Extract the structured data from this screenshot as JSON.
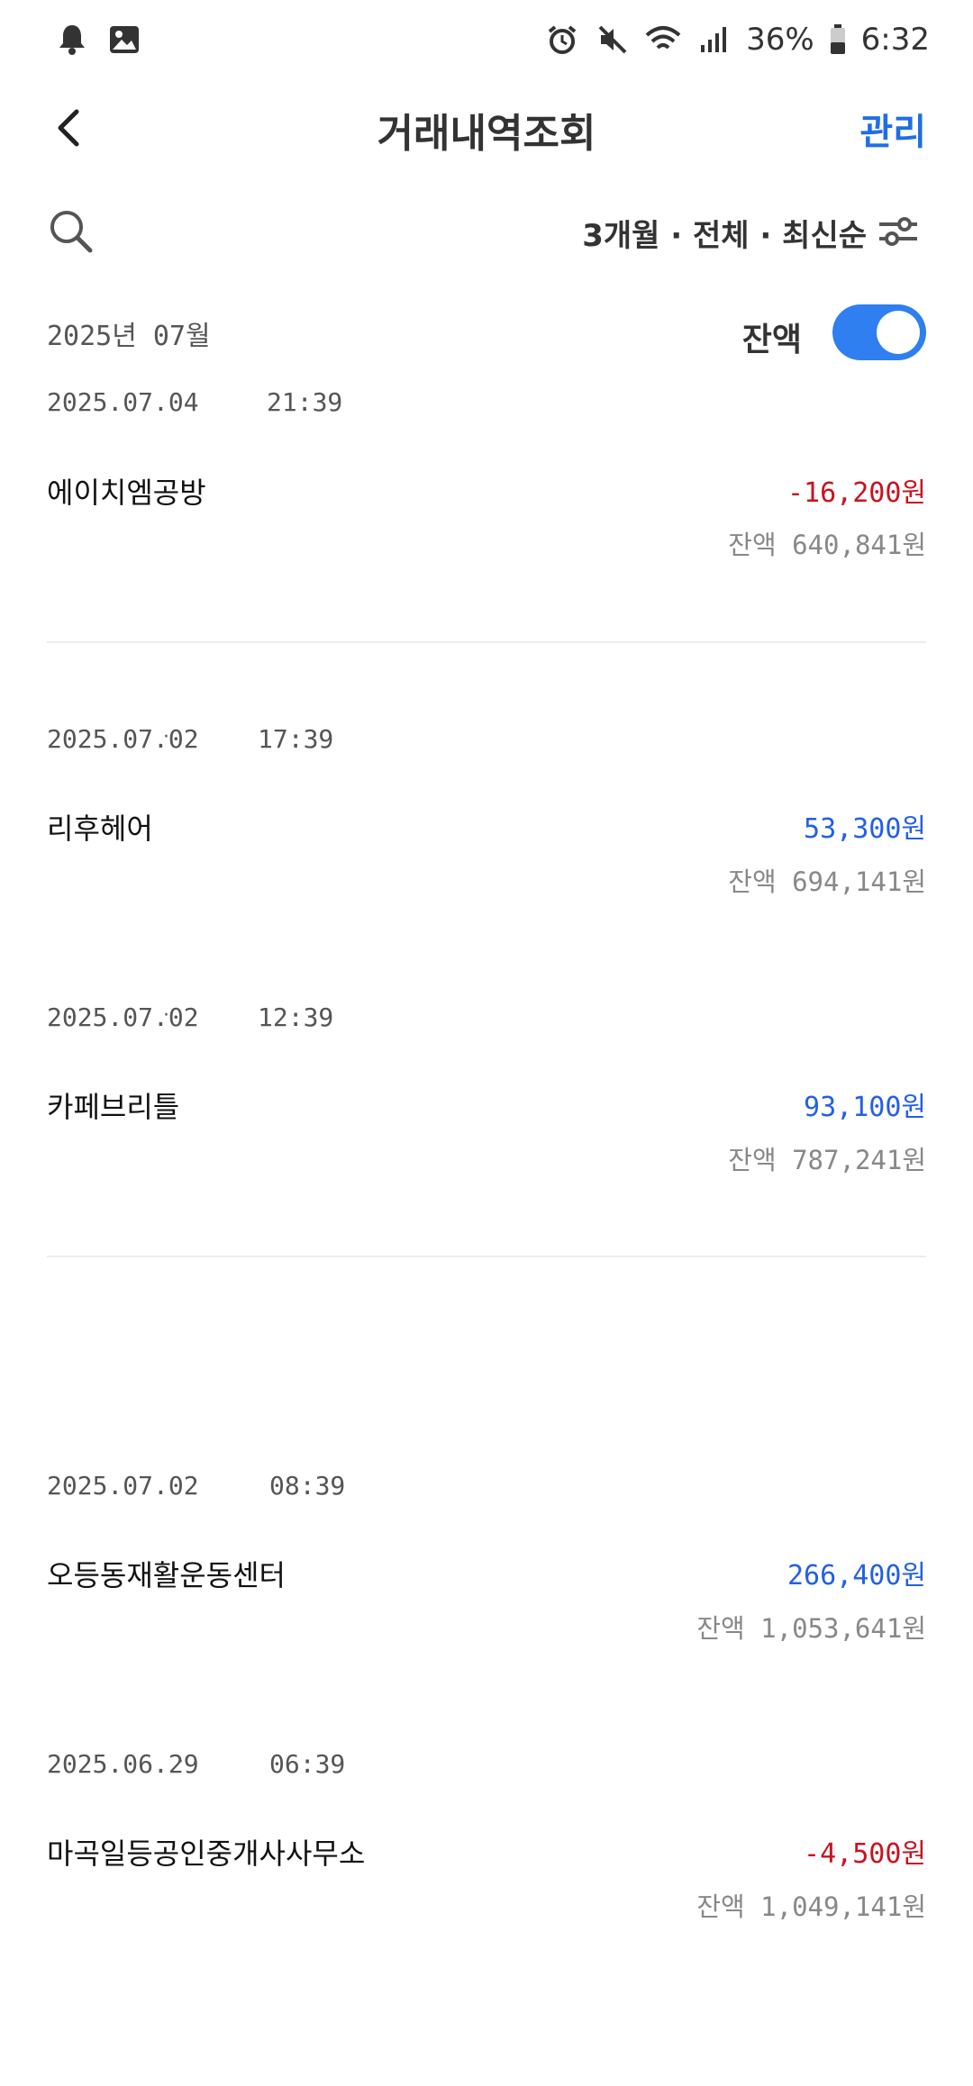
{
  "status_bar": {
    "battery": "36%",
    "time": "6:32"
  },
  "header": {
    "title": "거래내역조회",
    "manage_label": "관리"
  },
  "filter": {
    "summary": "3개월 · 전체 · 최신순"
  },
  "month": {
    "label": "2025년 07월",
    "balance_toggle_label": "잔액",
    "balance_toggle_on": true
  },
  "colors": {
    "accent": "#2f7ff0",
    "negative": "#c9121f",
    "positive": "#2260e6"
  },
  "transactions": [
    {
      "date": "2025.07.04",
      "time": "21:39",
      "name": "에이치엠공방",
      "amount": "-16,200원",
      "balance": "잔액 640,841원",
      "type": "neg"
    },
    {
      "date": "2025.07.02",
      "time": "17:39",
      "name": "리후헤어",
      "amount": "53,300원",
      "balance": "잔액 694,141원",
      "type": "pos"
    },
    {
      "date": "2025.07.02",
      "time": "12:39",
      "name": "카페브리틀",
      "amount": "93,100원",
      "balance": "잔액 787,241원",
      "type": "pos"
    },
    {
      "date": "2025.07.02",
      "time": "08:39",
      "name": "오등동재활운동센터",
      "amount": "266,400원",
      "balance": "잔액 1,053,641원",
      "type": "pos"
    },
    {
      "date": "2025.06.29",
      "time": "06:39",
      "name": "마곡일등공인중개사사무소",
      "amount": "-4,500원",
      "balance": "잔액 1,049,141원",
      "type": "neg"
    }
  ]
}
